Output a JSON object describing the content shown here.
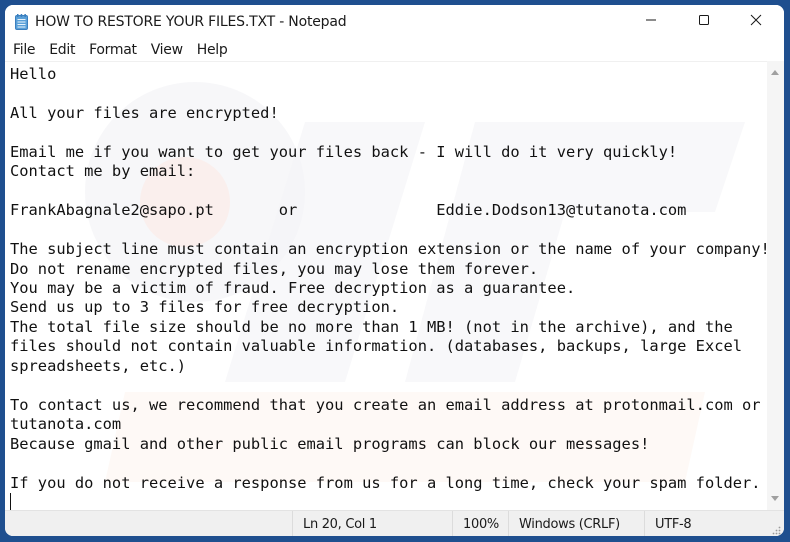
{
  "window": {
    "title": "HOW TO RESTORE YOUR FILES.TXT - Notepad",
    "app_icon": "notepad-icon",
    "controls": [
      "minimize-icon",
      "maximize-icon",
      "close-icon"
    ]
  },
  "menu": [
    {
      "label": "File"
    },
    {
      "label": "Edit"
    },
    {
      "label": "Format"
    },
    {
      "label": "View"
    },
    {
      "label": "Help"
    }
  ],
  "editor": {
    "lines": [
      "Hello",
      "",
      "All your files are encrypted!",
      "",
      "Email me if you want to get your files back - I will do it very quickly!",
      "Contact me by email:",
      "",
      "FrankAbagnale2@sapo.pt       or               Eddie.Dodson13@tutanota.com",
      "",
      "The subject line must contain an encryption extension or the name of your company!",
      "Do not rename encrypted files, you may lose them forever.",
      "You may be a victim of fraud. Free decryption as a guarantee.",
      "Send us up to 3 files for free decryption.",
      "The total file size should be no more than 1 MB! (not in the archive), and the",
      "files should not contain valuable information. (databases, backups, large Excel",
      "spreadsheets, etc.)",
      "",
      "To contact us, we recommend that you create an email address at protonmail.com or",
      "tutanota.com",
      "Because gmail and other public email programs can block our messages!",
      "",
      "If you do not receive a response from us for a long time, check your spam folder.",
      ""
    ]
  },
  "statusbar": {
    "position": "Ln 20, Col 1",
    "zoom": "100%",
    "line_endings": "Windows (CRLF)",
    "encoding": "UTF-8"
  },
  "colors": {
    "desktop_background": "#1f4f8f",
    "window_background": "#ffffff",
    "statusbar_background": "#f0f0f0"
  }
}
